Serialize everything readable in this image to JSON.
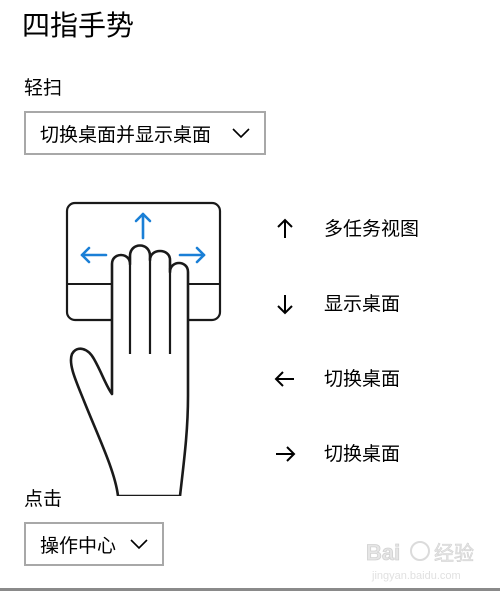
{
  "page": {
    "title": "四指手势"
  },
  "swipe": {
    "label": "轻扫",
    "selected": "切换桌面并显示桌面"
  },
  "gestures": [
    {
      "icon": "arrow-up-icon",
      "label": "多任务视图"
    },
    {
      "icon": "arrow-down-icon",
      "label": "显示桌面"
    },
    {
      "icon": "arrow-left-icon",
      "label": "切换桌面"
    },
    {
      "icon": "arrow-right-icon",
      "label": "切换桌面"
    }
  ],
  "tap": {
    "label": "点击",
    "selected": "操作中心"
  },
  "watermark": {
    "logo_text": "Baidu 经验",
    "url": "jingyan.baidu.com"
  },
  "colors": {
    "accent_blue": "#1a7fd6",
    "border_gray": "#a8a8a8",
    "text": "#000000"
  }
}
